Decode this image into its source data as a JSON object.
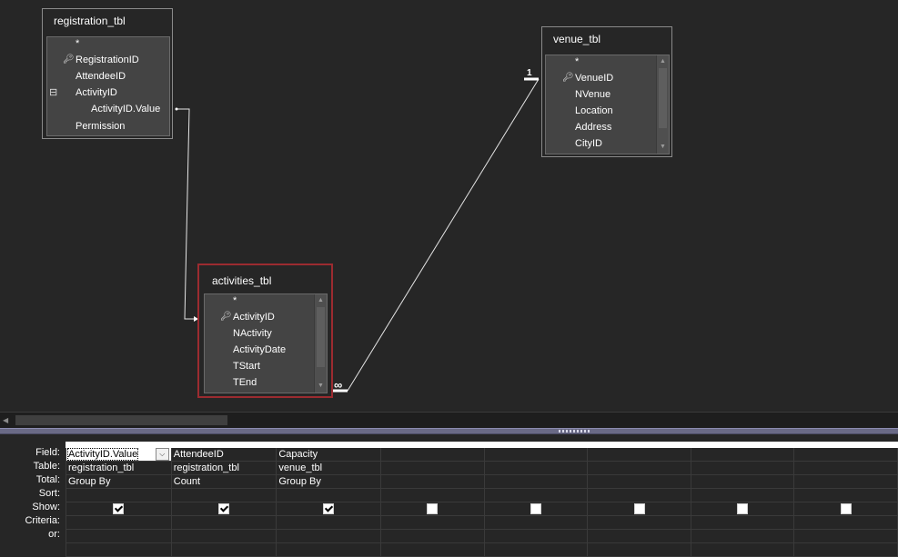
{
  "tables": {
    "registration": {
      "title": "registration_tbl",
      "fields": [
        "*",
        "RegistrationID",
        "AttendeeID",
        "ActivityID",
        "ActivityID.Value",
        "Permission"
      ]
    },
    "venue": {
      "title": "venue_tbl",
      "fields": [
        "*",
        "VenueID",
        "NVenue",
        "Location",
        "Address",
        "CityID"
      ]
    },
    "activities": {
      "title": "activities_tbl",
      "fields": [
        "*",
        "ActivityID",
        "NActivity",
        "ActivityDate",
        "TStart",
        "TEnd"
      ]
    }
  },
  "relationships": {
    "venue_activities": {
      "one_label": "1",
      "many_label": "∞"
    }
  },
  "grid": {
    "row_labels": [
      "Field:",
      "Table:",
      "Total:",
      "Sort:",
      "Show:",
      "Criteria:",
      "or:"
    ],
    "columns": [
      {
        "field": "ActivityID.Value",
        "table": "registration_tbl",
        "total": "Group By",
        "sort": "",
        "show": true
      },
      {
        "field": "AttendeeID",
        "table": "registration_tbl",
        "total": "Count",
        "sort": "",
        "show": true
      },
      {
        "field": "Capacity",
        "table": "venue_tbl",
        "total": "Group By",
        "sort": "",
        "show": true
      },
      {
        "field": "",
        "table": "",
        "total": "",
        "sort": "",
        "show": false
      },
      {
        "field": "",
        "table": "",
        "total": "",
        "sort": "",
        "show": false
      },
      {
        "field": "",
        "table": "",
        "total": "",
        "sort": "",
        "show": false
      },
      {
        "field": "",
        "table": "",
        "total": "",
        "sort": "",
        "show": false
      },
      {
        "field": "",
        "table": "",
        "total": "",
        "sort": "",
        "show": false
      }
    ]
  },
  "colors": {
    "background": "#262626",
    "selected_border": "#9c2b30",
    "field_list_body": "#444444"
  }
}
